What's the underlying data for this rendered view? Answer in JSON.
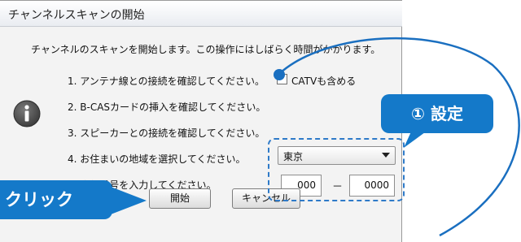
{
  "window": {
    "title": "チャンネルスキャンの開始"
  },
  "intro": "チャンネルのスキャンを開始します。この操作にはしばらく時間がかかります。",
  "steps": [
    "1. アンテナ線との接続を確認してください。",
    "2. B-CASカードの挿入を確認してください。",
    "3. スピーカーとの接続を確認してください。",
    "4. お住まいの地域を選択してください。",
    "5. 郵便番号を入力してください。"
  ],
  "catv_checkbox": {
    "label": "CATVも含める",
    "checked": false
  },
  "region_select": {
    "value": "東京"
  },
  "zip": {
    "first": "000",
    "separator": "－",
    "second": "0000"
  },
  "buttons": {
    "start": "開始",
    "cancel": "キャンセル"
  },
  "annotations": {
    "setting": "① 設定",
    "click": "クリック"
  },
  "colors": {
    "accent": "#1479c9",
    "dashed_frame": "#2e7ac8"
  },
  "icons": {
    "info": "info-icon",
    "dropdown": "chevron-down-icon"
  }
}
